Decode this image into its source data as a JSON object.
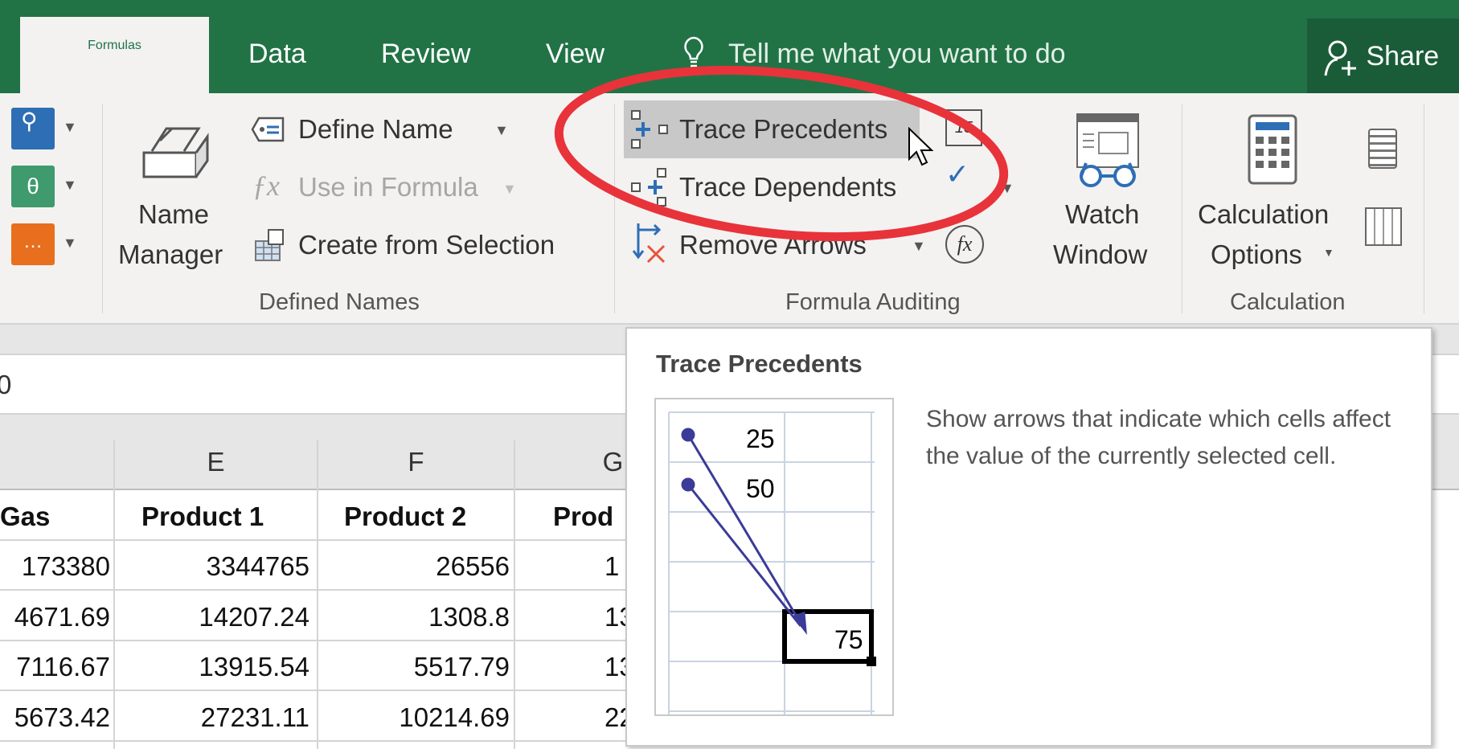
{
  "tabs": [
    {
      "label": "Formulas",
      "active": true
    },
    {
      "label": "Data"
    },
    {
      "label": "Review"
    },
    {
      "label": "View"
    }
  ],
  "tell_me": {
    "placeholder": "Tell me what you want to do",
    "icon": "lightbulb-icon"
  },
  "share": {
    "label": "Share",
    "icon": "person-add-icon"
  },
  "ribbon": {
    "defined_names": {
      "label": "Defined Names",
      "name_manager": [
        "Name",
        "Manager"
      ],
      "define_name": "Define Name",
      "use_in_formula": "Use in Formula",
      "create_from_selection": "Create from Selection"
    },
    "formula_auditing": {
      "label": "Formula Auditing",
      "trace_precedents": "Trace Precedents",
      "trace_dependents": "Trace Dependents",
      "remove_arrows": "Remove Arrows",
      "watch_window": [
        "Watch",
        "Window"
      ]
    },
    "calculation": {
      "label": "Calculation",
      "calculation_options": [
        "Calculation",
        "Options"
      ]
    }
  },
  "formula_bar": {
    "value": "0"
  },
  "columns": [
    "E",
    "F",
    "G"
  ],
  "table": {
    "headers": [
      "Gas",
      "Product 1",
      "Product 2",
      "Prod"
    ],
    "rows": [
      [
        "173380",
        "3344765",
        "26556",
        "1"
      ],
      [
        "4671.69",
        "14207.24",
        "1308.8",
        "13"
      ],
      [
        "7116.67",
        "13915.54",
        "5517.79",
        "13"
      ],
      [
        "5673.42",
        "27231.11",
        "10214.69",
        "22"
      ]
    ]
  },
  "tooltip": {
    "title": "Trace Precedents",
    "description": "Show arrows that indicate which cells affect the value of the currently selected cell.",
    "example": [
      "25",
      "50",
      "75"
    ]
  },
  "colors": {
    "brand_green": "#217346",
    "annotation_red": "#e8333a",
    "arrow_blue": "#3b3b98"
  }
}
